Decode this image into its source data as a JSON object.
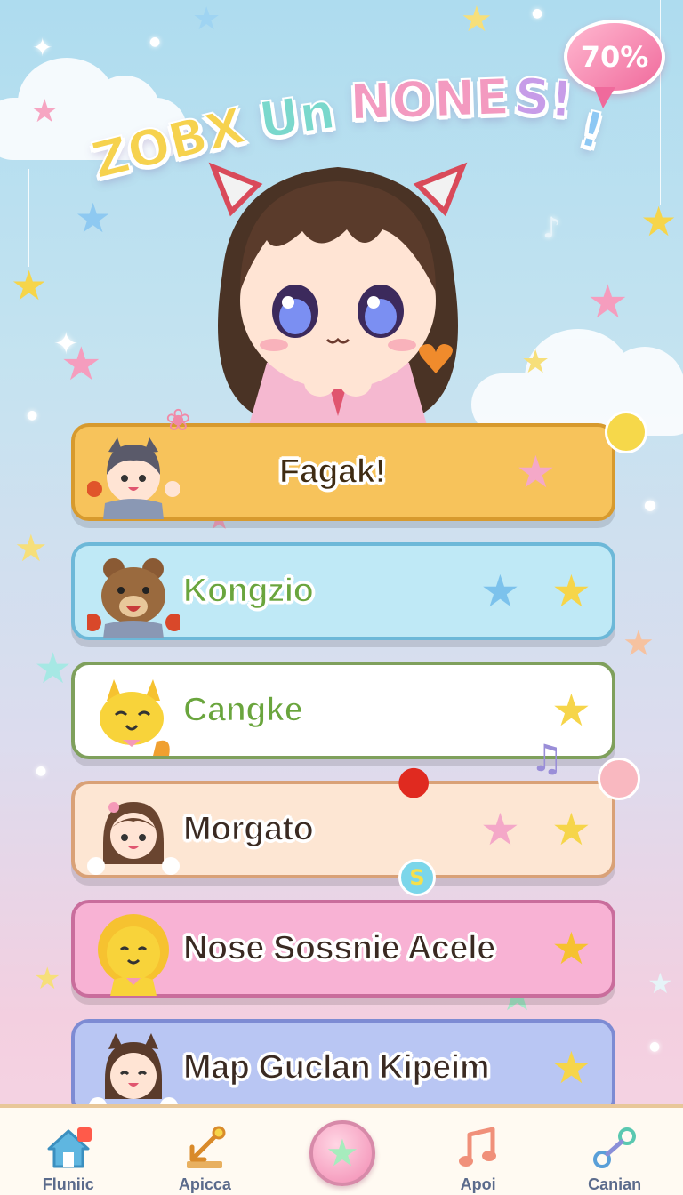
{
  "title": {
    "parts": [
      "ZOBX",
      "Un",
      "NONE",
      "S!",
      "!"
    ],
    "full": "ZOBX Un NONES!!"
  },
  "progress_bubble": {
    "value": "70%"
  },
  "menu": {
    "items": [
      {
        "label": "Fagak!",
        "color": "#f7c35b",
        "border": "#d79a2e",
        "stars": [
          "#f4a8c8"
        ],
        "text_color": "#3f2b12"
      },
      {
        "label": "Kongzio",
        "color": "#bfe9f6",
        "border": "#6db8d8",
        "stars": [
          "#7cc2ec",
          "#f6d54a"
        ],
        "text_color": "#6aa53d"
      },
      {
        "label": "Cangke",
        "color": "#ffffff",
        "border": "#7fa05c",
        "stars": [
          "#f6d54a"
        ],
        "text_color": "#6aa53d"
      },
      {
        "label": "Morgato",
        "color": "#fde6d3",
        "border": "#d9a177",
        "stars": [
          "#f4a8c8",
          "#f6d54a"
        ],
        "text_color": "#3a2a22"
      },
      {
        "label": "Nose Sossnie Acele",
        "color": "#f8b2d4",
        "border": "#c96d9c",
        "stars": [
          "#f6c230"
        ],
        "text_color": "#3a2a22"
      },
      {
        "label": "Map Guclan Kipeim",
        "color": "#b9c6f3",
        "border": "#7d8bd3",
        "stars": [
          "#f6d54a"
        ],
        "text_color": "#3a2a22"
      }
    ]
  },
  "bottom_nav": {
    "items": [
      {
        "label": "Fluniic",
        "icon": "home-icon"
      },
      {
        "label": "Apicca",
        "icon": "arrow-tool-icon"
      },
      {
        "label": "",
        "icon": "star-icon"
      },
      {
        "label": "Apoi",
        "icon": "music-note-icon"
      },
      {
        "label": "Canian",
        "icon": "link-icon"
      }
    ]
  },
  "colors": {
    "accent_pink": "#f28ab2",
    "nav_border": "#e8c799",
    "star_yellow": "#f6d54a"
  }
}
